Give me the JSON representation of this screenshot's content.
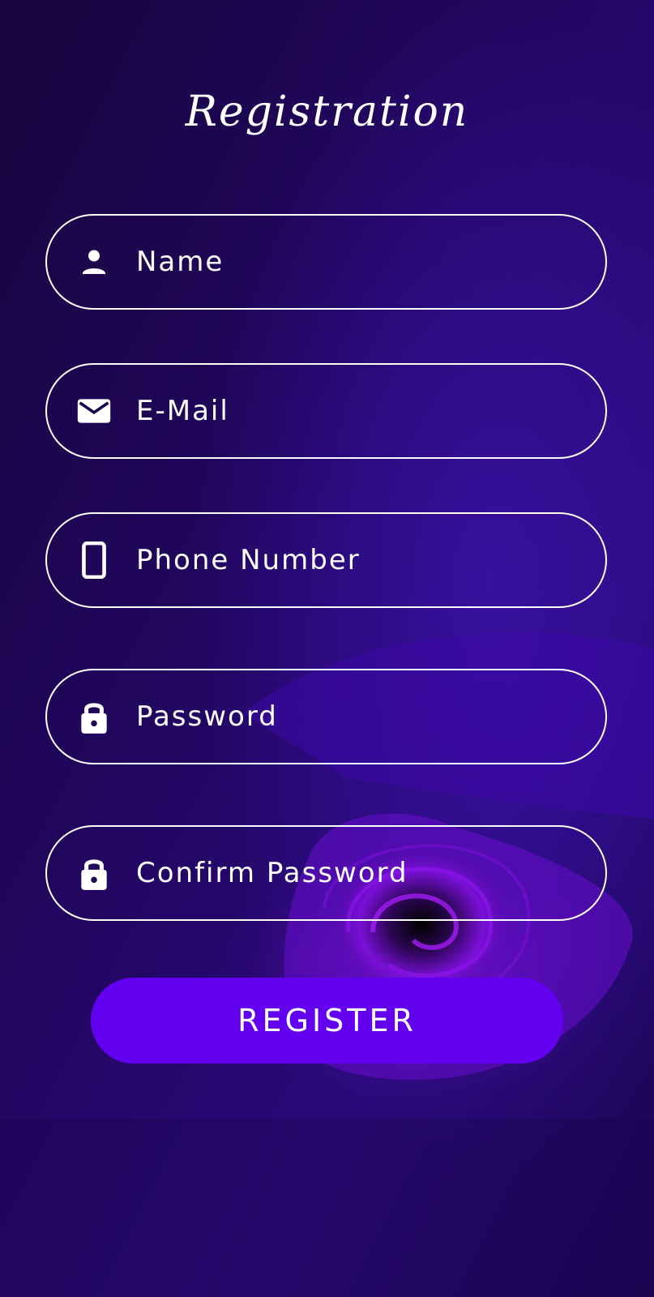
{
  "page": {
    "title": "Registration"
  },
  "form": {
    "fields": [
      {
        "id": "name",
        "placeholder": "Name",
        "value": "",
        "icon": "person-icon"
      },
      {
        "id": "email",
        "placeholder": "E-Mail",
        "value": "",
        "icon": "mail-icon"
      },
      {
        "id": "phone",
        "placeholder": "Phone Number",
        "value": "",
        "icon": "phone-icon"
      },
      {
        "id": "password",
        "placeholder": "Password",
        "value": "",
        "icon": "lock-icon"
      },
      {
        "id": "confirm_password",
        "placeholder": "Confirm Password",
        "value": "",
        "icon": "lock-icon"
      }
    ],
    "submit_label": "REGISTER"
  },
  "colors": {
    "background": "#1a0548",
    "accent": "#6300f0",
    "rose": "#8a10e8",
    "text": "#ffffff"
  }
}
